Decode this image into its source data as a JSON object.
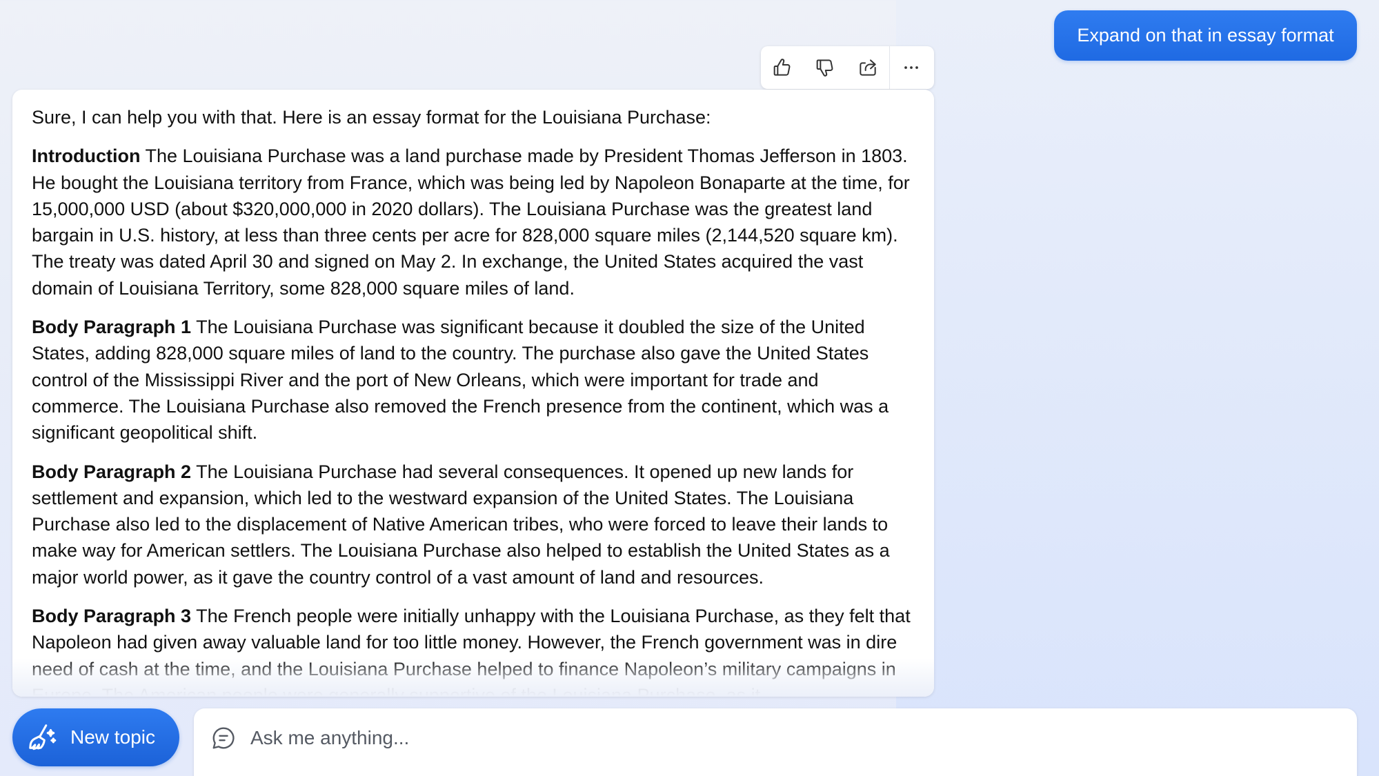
{
  "user_message": {
    "text": "Expand on that in essay format"
  },
  "toolbar": {
    "icons": [
      "thumbs-up-icon",
      "thumbs-down-icon",
      "share-icon",
      "more-icon"
    ]
  },
  "response": {
    "intro_line": "Sure, I can help you with that. Here is an essay format for the Louisiana Purchase:",
    "paragraphs": [
      {
        "heading": "Introduction",
        "text": " The Louisiana Purchase was a land purchase made by President Thomas Jefferson in 1803. He bought the Louisiana territory from France, which was being led by Napoleon Bonaparte at the time, for 15,000,000 USD (about $320,000,000 in 2020 dollars). The Louisiana Purchase was the greatest land bargain in U.S. history, at less than three cents per acre for 828,000 square miles (2,144,520 square km). The treaty was dated April 30 and signed on May 2. In exchange, the United States acquired the vast domain of Louisiana Territory, some 828,000 square miles of land."
      },
      {
        "heading": "Body Paragraph 1",
        "text": " The Louisiana Purchase was significant because it doubled the size of the United States, adding 828,000 square miles of land to the country. The purchase also gave the United States control of the Mississippi River and the port of New Orleans, which were important for trade and commerce. The Louisiana Purchase also removed the French presence from the continent, which was a significant geopolitical shift."
      },
      {
        "heading": "Body Paragraph 2",
        "text": " The Louisiana Purchase had several consequences. It opened up new lands for settlement and expansion, which led to the westward expansion of the United States. The Louisiana Purchase also led to the displacement of Native American tribes, who were forced to leave their lands to make way for American settlers. The Louisiana Purchase also helped to establish the United States as a major world power, as it gave the country control of a vast amount of land and resources."
      },
      {
        "heading": "Body Paragraph 3",
        "text": " The French people were initially unhappy with the Louisiana Purchase, as they felt that Napoleon had given away valuable land for too little money. However, the French government was in dire need of cash at the time, and the Louisiana Purchase helped to finance Napoleon’s military campaigns in Europe. The American people were generally supportive of the Louisiana Purchase, as it"
      }
    ]
  },
  "bottom_bar": {
    "new_topic_label": "New topic",
    "ask_placeholder": "Ask me anything..."
  },
  "colors": {
    "accent": "#1f6ae3",
    "background": "#eef1f8"
  }
}
